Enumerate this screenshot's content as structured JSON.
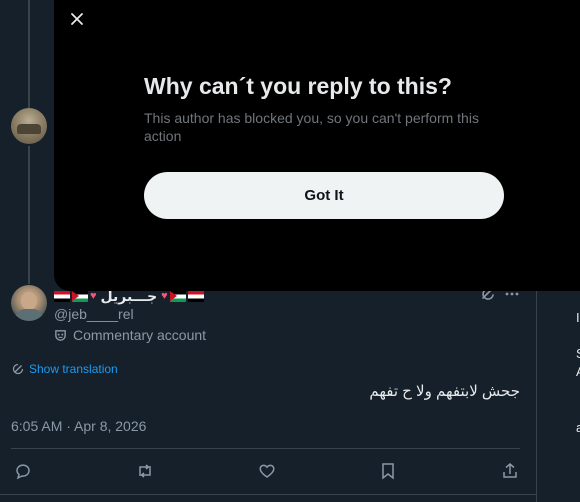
{
  "modal": {
    "title": "Why can´t you reply to this?",
    "body": "This author has blocked you, so you can't perform this action",
    "button_label": "Got It",
    "close_icon": "close-icon"
  },
  "tweet": {
    "display_name": "جـــبريل",
    "handle": "@jeb____rel",
    "account_label": "Commentary account",
    "translation_link": "Show translation",
    "text": "جحش لابتفهم ولا ح تفهم",
    "timestamp": "6:05 AM · Apr 8, 2026",
    "icons": {
      "grok": "grok-icon",
      "more": "more-icon",
      "reply": "reply-icon",
      "retweet": "retweet-icon",
      "like": "like-icon",
      "bookmark": "bookmark-icon",
      "share": "share-icon",
      "translate": "translate-icon",
      "label": "mask-icon"
    }
  },
  "sidebar_glimpse": [
    "I",
    "S",
    "A",
    "a"
  ],
  "colors": {
    "background": "#15202b",
    "modal": "#000000",
    "accent": "#1d9bf0",
    "muted": "#8b98a5",
    "heart": "#f2577b"
  }
}
